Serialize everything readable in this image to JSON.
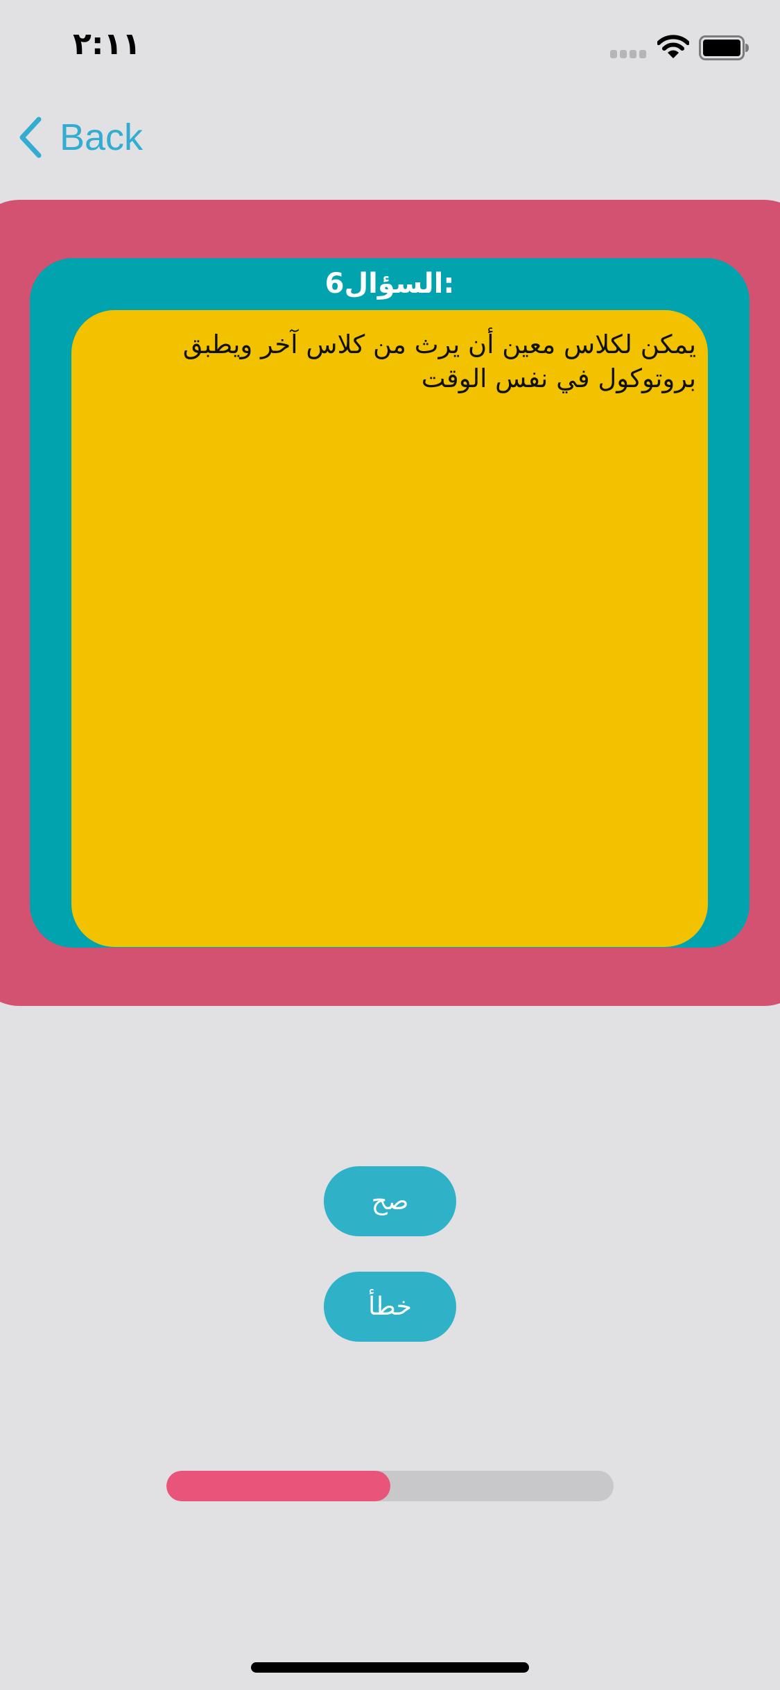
{
  "status_bar": {
    "time": "٢:١١"
  },
  "nav": {
    "back_label": "Back"
  },
  "question": {
    "title": "السؤال6:",
    "text": "يمكن لكلاس معين أن يرث من كلاس آخر ويطبق بروتوكول في نفس الوقت"
  },
  "answers": {
    "true_label": "صح",
    "false_label": "خطأ"
  },
  "progress": {
    "fraction": 0.5
  },
  "colors": {
    "outer_card": "#d35271",
    "middle_card": "#00a3ae",
    "inner_card": "#f2c200",
    "button": "#2fb1c8",
    "progress_fill": "#e9557a",
    "accent": "#32acd0"
  }
}
